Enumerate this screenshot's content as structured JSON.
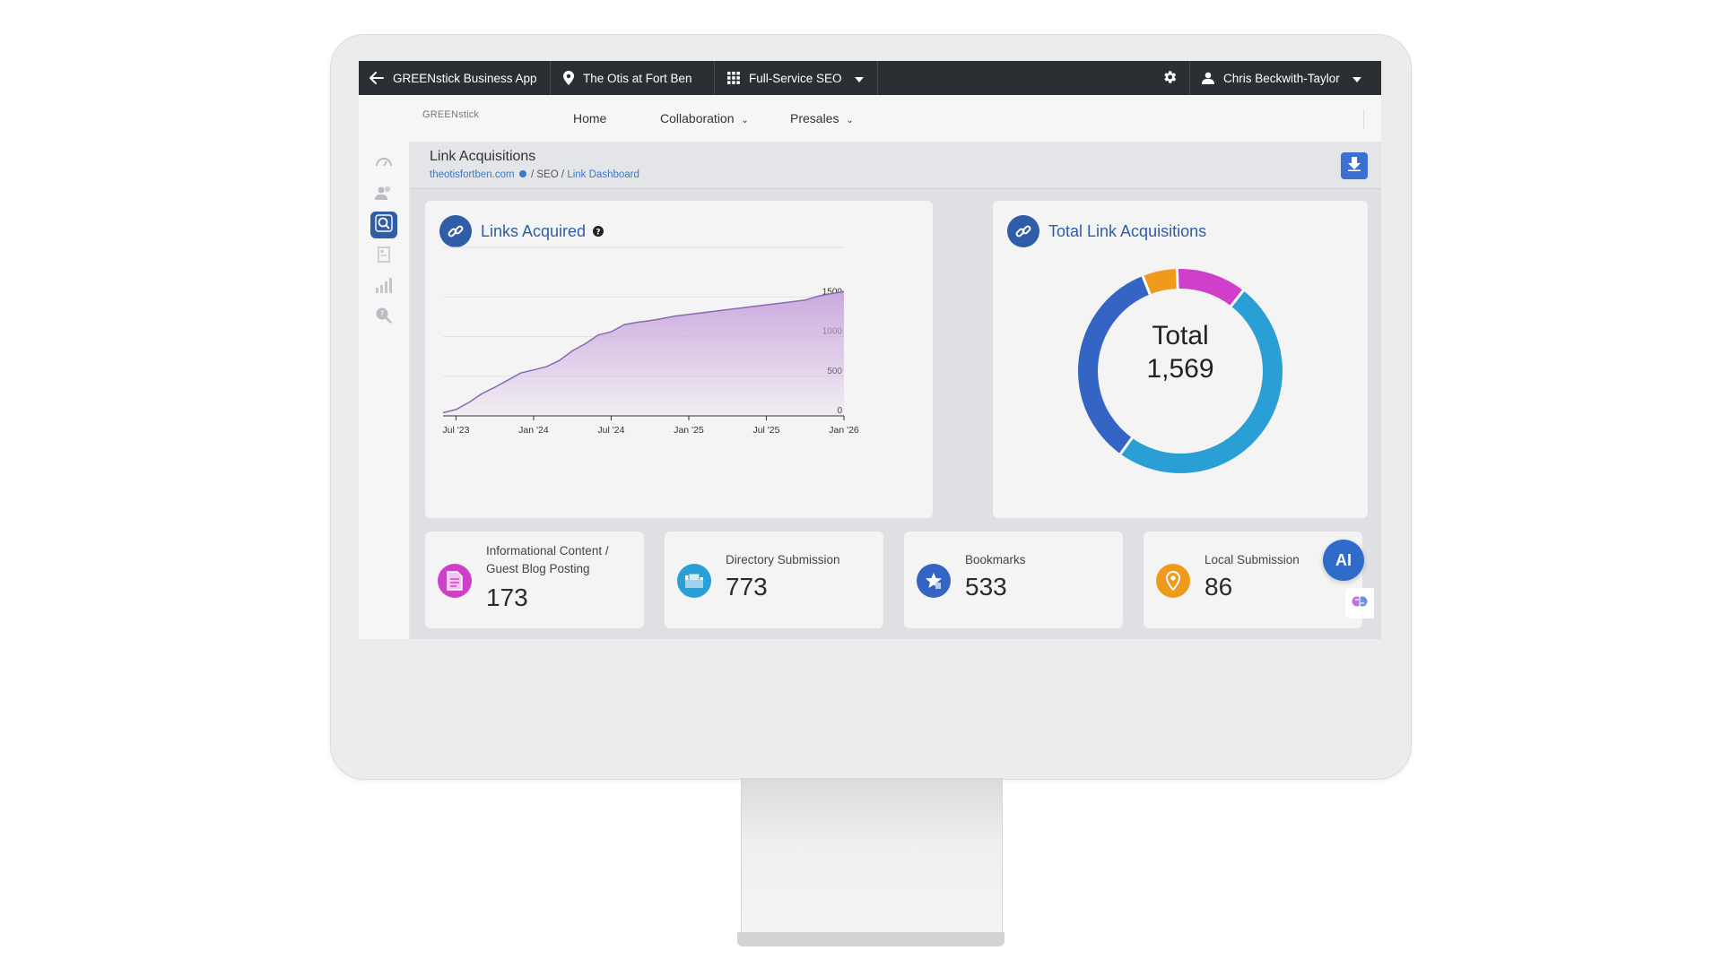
{
  "topbar": {
    "app_name": "GREENstick Business App",
    "location": "The Otis at Fort Ben",
    "product": "Full-Service SEO",
    "user": "Chris Beckwith-Taylor"
  },
  "navbar": {
    "logo_text": "GREENstick",
    "links": [
      {
        "label": "Home"
      },
      {
        "label": "Collaboration"
      },
      {
        "label": "Presales"
      }
    ]
  },
  "sidebar": {
    "icons": [
      "dashboard-icon",
      "users-icon",
      "seo-search-icon",
      "document-icon",
      "bar-chart-icon",
      "search-help-icon"
    ],
    "active": "seo-search-icon"
  },
  "page": {
    "title": "Link Acquisitions",
    "breadcrumb": {
      "site": "theotisfortben.com",
      "section": "SEO",
      "current": "Link Dashboard"
    }
  },
  "links_card": {
    "title": "Links Acquired",
    "help_icon": "question-icon"
  },
  "total_card": {
    "title": "Total Link Acquisitions",
    "center_label": "Total",
    "center_value": "1,569"
  },
  "stats": [
    {
      "label_line1": "Informational Content /",
      "label_line2": "Guest Blog Posting",
      "value": "173",
      "icon": "document-icon",
      "color": "#cf3fc9"
    },
    {
      "label_line1": "Directory Submission",
      "value": "773",
      "icon": "folder-icon",
      "color": "#2a9fd6"
    },
    {
      "label_line1": "Bookmarks",
      "value": "533",
      "icon": "star-bookmark-icon",
      "color": "#3464c4"
    },
    {
      "label_line1": "Local Submission",
      "value": "86",
      "icon": "map-pin-icon",
      "color": "#ef9a1a"
    }
  ],
  "ai_badge": "AI",
  "colors": {
    "topbar": "#2b2f33",
    "accent": "#2f5da8",
    "area_fill": "#c9a5dd",
    "line": "#8a6ab0"
  },
  "chart_data": [
    {
      "type": "area",
      "title": "Links Acquired",
      "x": [
        "2023-06",
        "2023-07",
        "2023-08",
        "2023-09",
        "2023-10",
        "2023-11",
        "2023-12",
        "2024-01",
        "2024-02",
        "2024-03",
        "2024-04",
        "2024-05",
        "2024-06",
        "2024-07",
        "2024-08",
        "2024-09",
        "2024-10",
        "2024-11",
        "2024-12",
        "2025-01",
        "2025-02",
        "2025-03",
        "2025-04",
        "2025-05",
        "2025-06",
        "2025-07",
        "2025-08",
        "2025-09",
        "2025-10",
        "2025-11",
        "2025-12",
        "2026-01"
      ],
      "values": [
        40,
        80,
        170,
        280,
        360,
        450,
        540,
        580,
        620,
        700,
        820,
        910,
        1020,
        1060,
        1150,
        1180,
        1200,
        1230,
        1260,
        1280,
        1300,
        1320,
        1340,
        1360,
        1380,
        1400,
        1420,
        1440,
        1460,
        1510,
        1540,
        1569
      ],
      "xticks": [
        "Jul '23",
        "Jan '24",
        "Jul '24",
        "Jan '25",
        "Jul '25",
        "Jan '26"
      ],
      "yticks": [
        "0",
        "500",
        "1000",
        "1500"
      ],
      "ylim": [
        0,
        1650
      ],
      "grid": true
    },
    {
      "type": "pie",
      "title": "Total Link Acquisitions",
      "labels": [
        "Directory Submission",
        "Bookmarks",
        "Local Submission",
        "Informational Content / Guest Blog Posting"
      ],
      "values": [
        773,
        533,
        86,
        173
      ],
      "colors": [
        "#2a9fd6",
        "#3464c4",
        "#ef9a1a",
        "#cf3fc9"
      ]
    }
  ]
}
